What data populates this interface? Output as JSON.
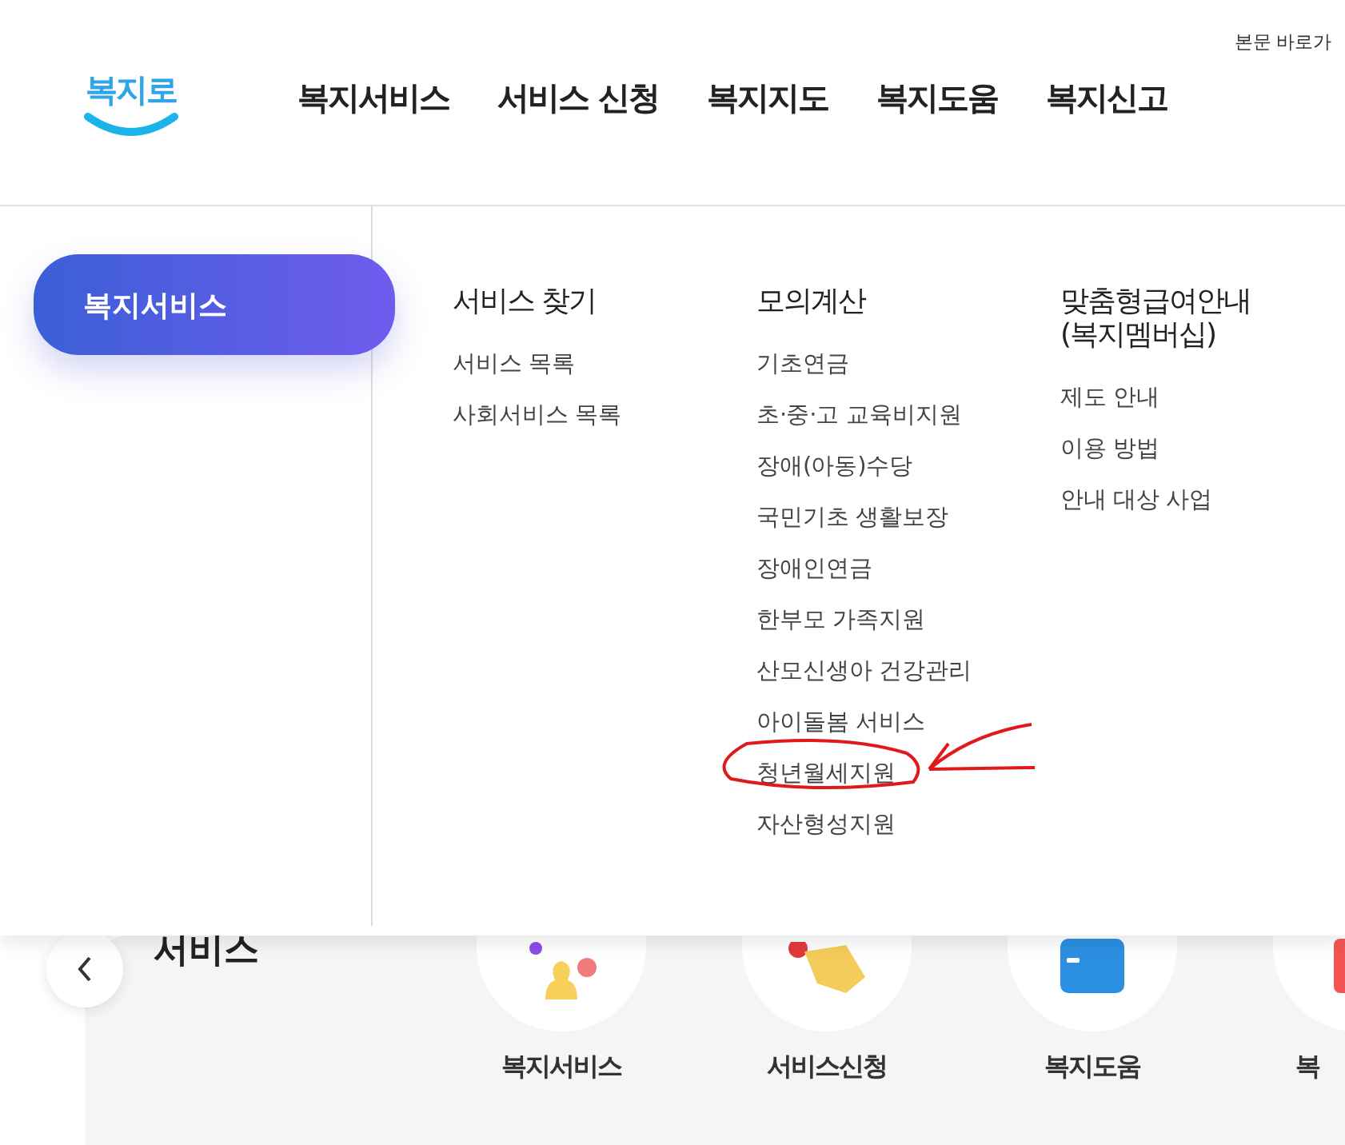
{
  "header": {
    "skip_link": "본문 바로가",
    "logo": "복지로",
    "nav": [
      "복지서비스",
      "서비스 신청",
      "복지지도",
      "복지도움",
      "복지신고"
    ]
  },
  "mega_menu": {
    "active_section": "복지서비스",
    "columns": [
      {
        "heading": "서비스 찾기",
        "items": [
          {
            "label": "서비스 목록",
            "circled": false
          },
          {
            "label": "사회서비스 목록",
            "circled": false
          }
        ]
      },
      {
        "heading": "모의계산",
        "items": [
          {
            "label": "기초연금",
            "circled": false
          },
          {
            "label": "초·중·고 교육비지원",
            "circled": false
          },
          {
            "label": "장애(아동)수당",
            "circled": false
          },
          {
            "label": "국민기초 생활보장",
            "circled": false
          },
          {
            "label": "장애인연금",
            "circled": false
          },
          {
            "label": "한부모 가족지원",
            "circled": false
          },
          {
            "label": "산모신생아 건강관리",
            "circled": false
          },
          {
            "label": "아이돌봄 서비스",
            "circled": false
          },
          {
            "label": "청년월세지원",
            "circled": true
          },
          {
            "label": "자산형성지원",
            "circled": false
          }
        ]
      },
      {
        "heading": "맞춤형급여안내\n(복지멤버십)",
        "items": [
          {
            "label": "제도 안내",
            "circled": false
          },
          {
            "label": "이용 방법",
            "circled": false
          },
          {
            "label": "안내 대상 사업",
            "circled": false
          }
        ]
      }
    ]
  },
  "quick_services": {
    "title": "서비스",
    "items": [
      {
        "label": "복지서비스",
        "kind": "person"
      },
      {
        "label": "서비스신청",
        "kind": "hand"
      },
      {
        "label": "복지도움",
        "kind": "folder"
      },
      {
        "label": "복",
        "kind": "report"
      }
    ]
  }
}
